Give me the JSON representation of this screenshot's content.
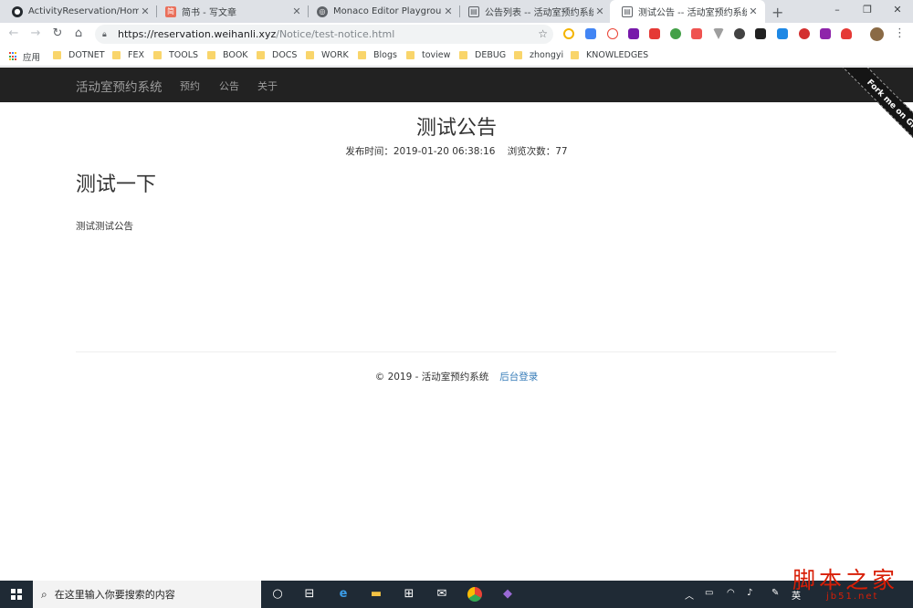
{
  "browser": {
    "tabs": [
      {
        "label": "ActivityReservation/HomeCo",
        "icon": "github-icon"
      },
      {
        "label": "简书 - 写文章",
        "icon": "jianshu-icon"
      },
      {
        "label": "Monaco Editor Playground",
        "icon": "globe-icon"
      },
      {
        "label": "公告列表 -- 活动室预约系统",
        "icon": "page-icon"
      },
      {
        "label": "测试公告 -- 活动室预约系统",
        "icon": "page-icon"
      }
    ],
    "active_tab": 4,
    "url_host": "https://reservation.weihanli.xyz",
    "url_path": "/Notice/test-notice.html",
    "bookmarks": [
      "应用",
      "DOTNET",
      "FEX",
      "TOOLS",
      "BOOK",
      "DOCS",
      "WORK",
      "Blogs",
      "toview",
      "DEBUG",
      "zhongyi",
      "KNOWLEDGES"
    ]
  },
  "site": {
    "brand": "活动室预约系统",
    "nav": [
      "预约",
      "公告",
      "关于"
    ],
    "ribbon": "Fork me on GitHub"
  },
  "notice": {
    "title": "测试公告",
    "publish_label": "发布时间：2019-01-20 06:38:16",
    "views_label": "浏览次数：77",
    "heading": "测试一下",
    "body": "测试测试公告"
  },
  "footer": {
    "copyright": "© 2019 - 活动室预约系统",
    "admin_link": "后台登录"
  },
  "taskbar": {
    "search_placeholder": "在这里输入你要搜索的内容",
    "lang": "英"
  },
  "watermark": {
    "text": "脚本之家",
    "url": "jb51.net"
  }
}
